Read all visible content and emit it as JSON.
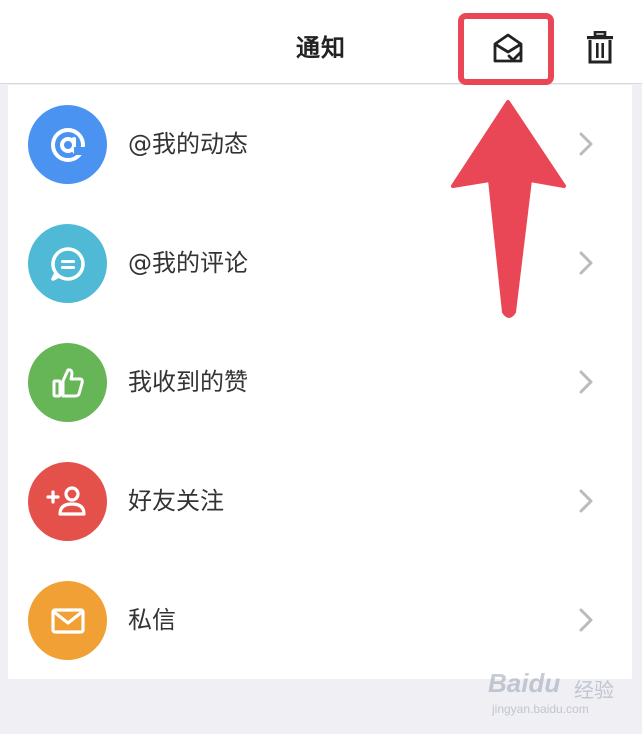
{
  "header": {
    "title": "通知"
  },
  "notification_items": [
    {
      "label": "@我的动态",
      "icon": "at-icon",
      "color": "#4b93f0"
    },
    {
      "label": "@我的评论",
      "icon": "comment-icon",
      "color": "#4fb9d6"
    },
    {
      "label": "我收到的赞",
      "icon": "thumbs-up-icon",
      "color": "#66b557"
    },
    {
      "label": "好友关注",
      "icon": "add-friend-icon",
      "color": "#e4514a"
    },
    {
      "label": "私信",
      "icon": "mail-icon",
      "color": "#f0a034"
    }
  ],
  "annotation": {
    "highlight_color": "#ea4756"
  },
  "watermark": {
    "logo": "Baidu",
    "text": "经验",
    "url": "jingyan.baidu.com"
  }
}
